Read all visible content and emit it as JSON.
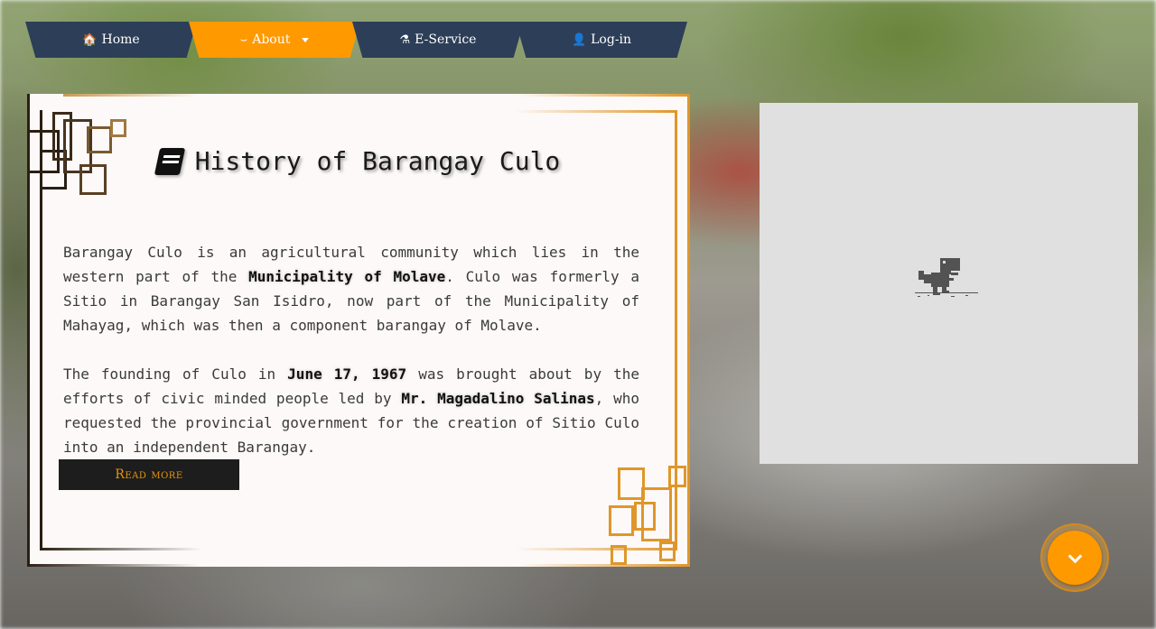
{
  "nav": {
    "items": [
      {
        "label": "Home",
        "icon": "home-icon",
        "active": false
      },
      {
        "label": "About",
        "icon": "smile-icon",
        "active": true,
        "dropdown": true
      },
      {
        "label": "E-Service",
        "icon": "flask-icon",
        "active": false
      },
      {
        "label": "Log-in",
        "icon": "user-icon",
        "active": false
      }
    ]
  },
  "card": {
    "title": "History of Barangay Culo",
    "title_icon": "book-icon",
    "p1": {
      "t1": "Barangay Culo is an agricultural community which lies in the western part of the ",
      "h1": "Municipality of Molave",
      "t2": ". Culo was formerly a Sitio in Barangay San Isidro, now part of the Municipality of Mahayag, which was then a component barangay of Molave."
    },
    "p2": {
      "t1": "The founding of Culo in ",
      "h1": "June 17, 1967",
      "t2": " was brought about by the efforts of civic minded people led by ",
      "h2": "Mr. Magadalino Salinas",
      "t3": ", who requested the provincial government for the creation of Sitio Culo into an independent Barangay."
    },
    "read_more": "Read more"
  },
  "game": {
    "icon": "dino-icon"
  },
  "scroll": {
    "icon": "chevron-down-icon"
  },
  "colors": {
    "nav_bg": "#2d3e58",
    "accent": "#ff9900",
    "card_bg": "#fcf9f8",
    "frame_dark": "#2b1f14",
    "frame_gold": "#e0962a"
  }
}
